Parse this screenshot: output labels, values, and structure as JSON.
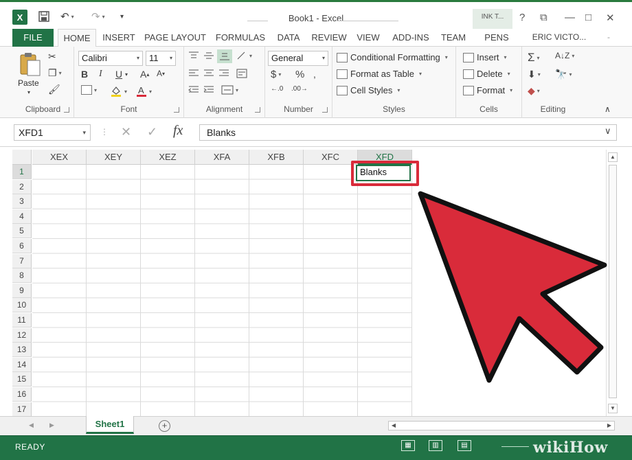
{
  "window": {
    "title": "Book1 - Excel",
    "ink_tab": "INK T...",
    "user": "ERIC VICTO..."
  },
  "tabs": [
    {
      "label": "FILE"
    },
    {
      "label": "HOME"
    },
    {
      "label": "INSERT"
    },
    {
      "label": "PAGE LAYOUT"
    },
    {
      "label": "FORMULAS"
    },
    {
      "label": "DATA"
    },
    {
      "label": "REVIEW"
    },
    {
      "label": "VIEW"
    },
    {
      "label": "ADD-INS"
    },
    {
      "label": "TEAM"
    },
    {
      "label": "PENS"
    }
  ],
  "ribbon": {
    "clipboard": {
      "label": "Clipboard",
      "paste": "Paste"
    },
    "font": {
      "label": "Font",
      "name": "Calibri",
      "size": "11",
      "bold": "B",
      "italic": "I",
      "underline": "U"
    },
    "alignment": {
      "label": "Alignment"
    },
    "number": {
      "label": "Number",
      "format": "General",
      "currency": "$",
      "percent": "%"
    },
    "styles": {
      "label": "Styles",
      "conditional": "Conditional Formatting",
      "table": "Format as Table",
      "cell_styles": "Cell Styles"
    },
    "cells": {
      "label": "Cells",
      "insert": "Insert",
      "delete": "Delete",
      "format": "Format"
    },
    "editing": {
      "label": "Editing"
    }
  },
  "formula_bar": {
    "name_box": "XFD1",
    "fx": "fx",
    "content": "Blanks"
  },
  "grid": {
    "columns": [
      "XEX",
      "XEY",
      "XEZ",
      "XFA",
      "XFB",
      "XFC",
      "XFD"
    ],
    "rows": [
      "1",
      "2",
      "3",
      "4",
      "5",
      "6",
      "7",
      "8",
      "9",
      "10",
      "11",
      "12",
      "13",
      "14",
      "15",
      "16",
      "17"
    ],
    "active_cell_value": "Blanks"
  },
  "sheets": {
    "active": "Sheet1"
  },
  "status": {
    "text": "READY"
  },
  "watermark": "wikiHow",
  "colors": {
    "excel_green": "#217346",
    "highlight_red": "#d92b3a"
  }
}
